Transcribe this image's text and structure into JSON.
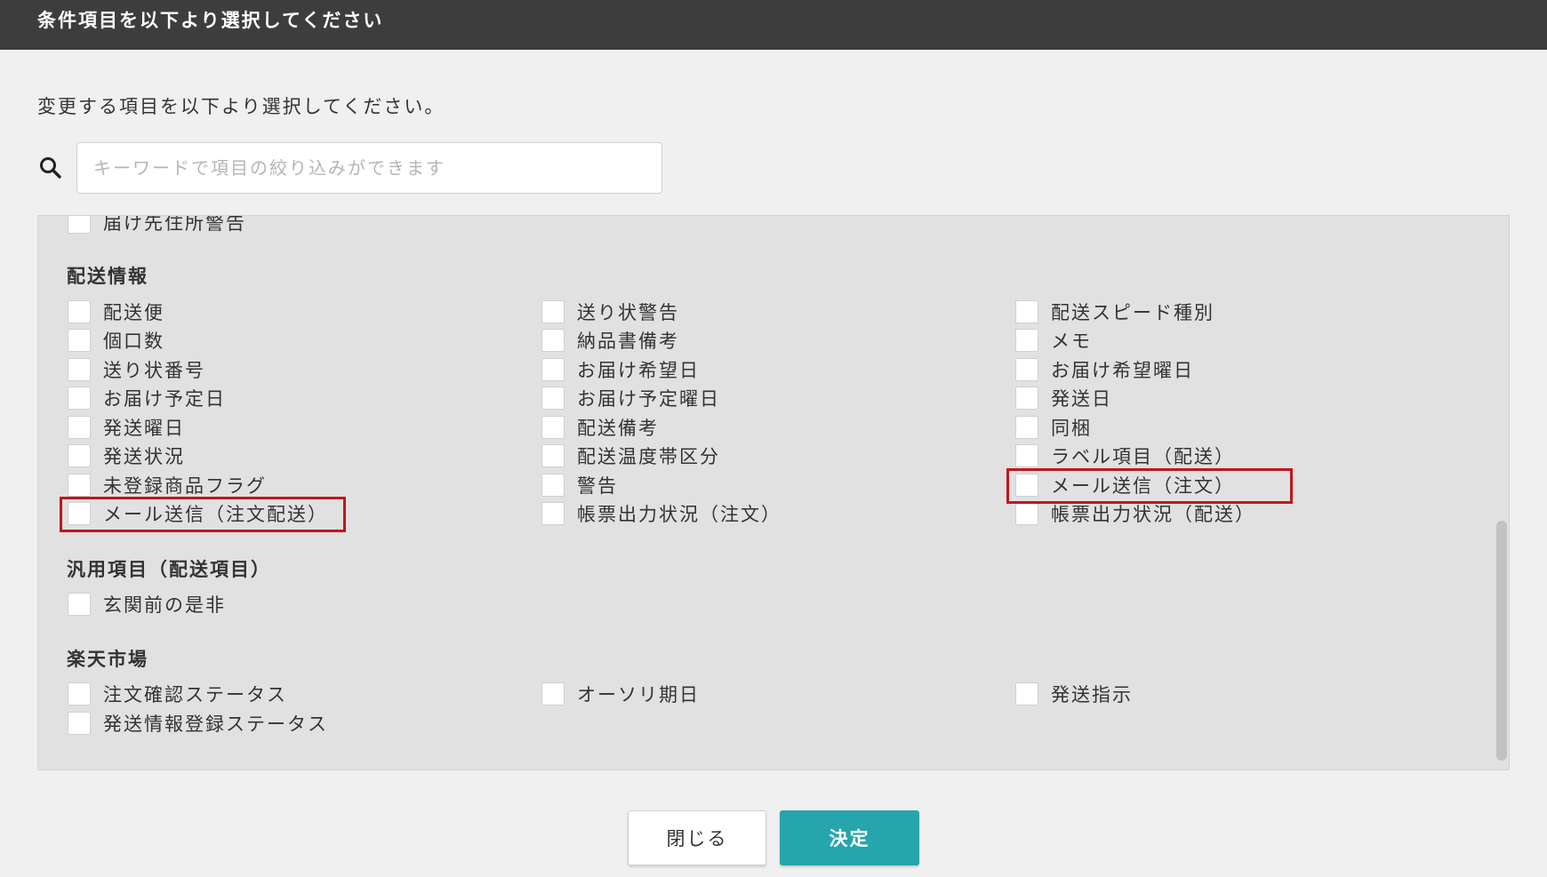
{
  "dialog": {
    "title": "条件項目を以下より選択してください",
    "instruction": "変更する項目を以下より選択してください。",
    "search": {
      "placeholder": "キーワードで項目の絞り込みができます",
      "value": ""
    }
  },
  "colors": {
    "header_bg": "#3d3d3d",
    "primary": "#27a5ad",
    "highlight": "#c0161c"
  },
  "top_partial_item": "届け先住所警告",
  "sections": [
    {
      "title": "配送情報",
      "items": [
        [
          "配送便",
          "送り状警告",
          "配送スピード種別"
        ],
        [
          "個口数",
          "納品書備考",
          "メモ"
        ],
        [
          "送り状番号",
          "お届け希望日",
          "お届け希望曜日"
        ],
        [
          "お届け予定日",
          "お届け予定曜日",
          "発送日"
        ],
        [
          "発送曜日",
          "配送備考",
          "同梱"
        ],
        [
          "発送状況",
          "配送温度帯区分",
          "ラベル項目（配送）"
        ],
        [
          "未登録商品フラグ",
          "警告",
          "メール送信（注文）"
        ],
        [
          "メール送信（注文配送）",
          "帳票出力状況（注文）",
          "帳票出力状況（配送）"
        ]
      ]
    },
    {
      "title": "汎用項目（配送項目）",
      "items": [
        [
          "玄関前の是非"
        ]
      ]
    },
    {
      "title": "楽天市場",
      "items": [
        [
          "注文確認ステータス",
          "オーソリ期日",
          "発送指示"
        ],
        [
          "発送情報登録ステータス"
        ]
      ]
    }
  ],
  "buttons": {
    "close": "閉じる",
    "ok": "決定"
  }
}
